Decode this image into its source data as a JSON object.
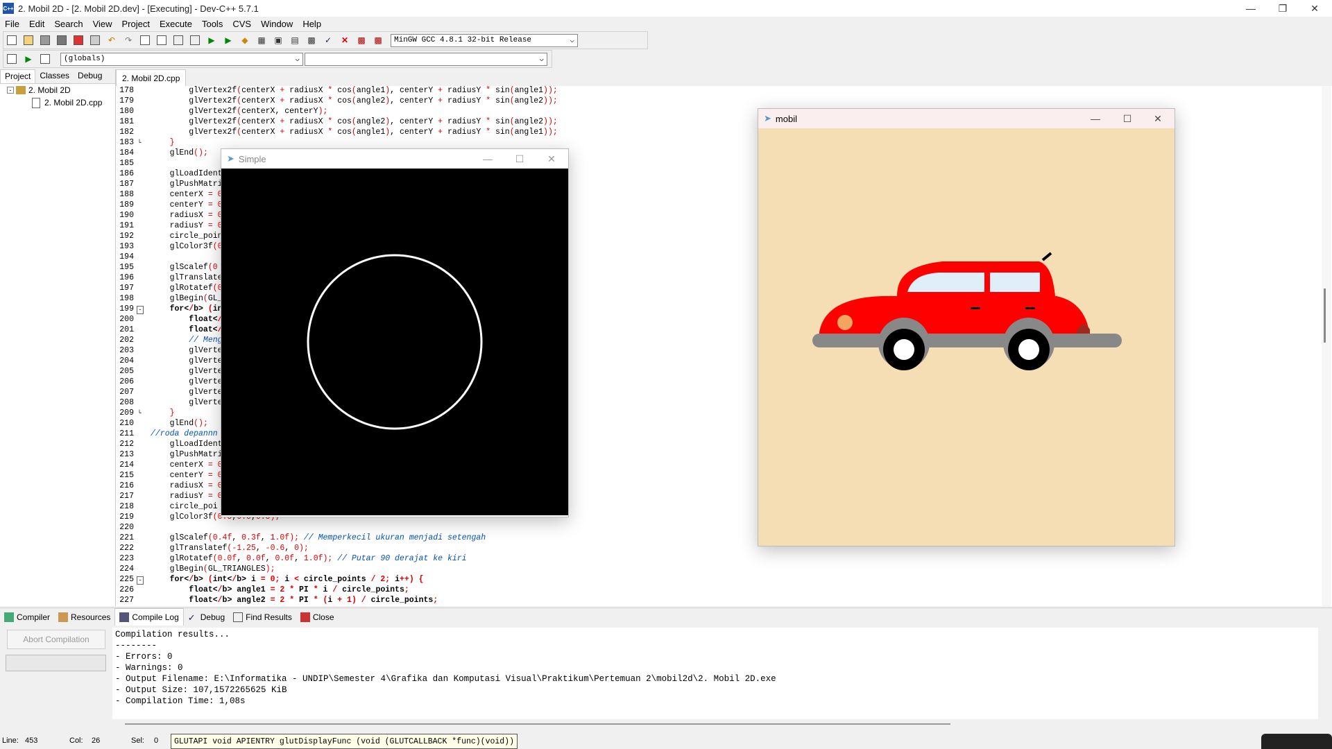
{
  "window": {
    "title": "2. Mobil 2D - [2. Mobil 2D.dev] - [Executing] - Dev-C++ 5.7.1",
    "icon": "devcpp-icon"
  },
  "menu": [
    "File",
    "Edit",
    "Search",
    "View",
    "Project",
    "Execute",
    "Tools",
    "CVS",
    "Window",
    "Help"
  ],
  "toolbar": {
    "compiler": "MinGW GCC 4.8.1 32-bit Release",
    "scope": "(globals)",
    "members": ""
  },
  "left_panel": {
    "tabs": [
      "Project",
      "Classes",
      "Debug"
    ],
    "tree": [
      {
        "label": "2. Mobil 2D",
        "level": 0
      },
      {
        "label": "2. Mobil 2D.cpp",
        "level": 1
      }
    ]
  },
  "editor": {
    "tab": "2. Mobil 2D.cpp",
    "lines": [
      {
        "n": "178",
        "t": "        glVertex2f(centerX + radiusX * cos(angle1), centerY + radiusY * sin(angle1));"
      },
      {
        "n": "179",
        "t": "        glVertex2f(centerX + radiusX * cos(angle2), centerY + radiusY * sin(angle2));"
      },
      {
        "n": "180",
        "t": "        glVertex2f(centerX, centerY);"
      },
      {
        "n": "181",
        "t": "        glVertex2f(centerX + radiusX * cos(angle2), centerY + radiusY * sin(angle2));"
      },
      {
        "n": "182",
        "t": "        glVertex2f(centerX + radiusX * cos(angle1), centerY + radiusY * sin(angle1));"
      },
      {
        "n": "183",
        "t": "    }"
      },
      {
        "n": "184",
        "t": "    glEnd();"
      },
      {
        "n": "185",
        "t": ""
      },
      {
        "n": "186",
        "t": "    glLoadIdent"
      },
      {
        "n": "187",
        "t": "    glPushMatri"
      },
      {
        "n": "188",
        "t": "    centerX = 0"
      },
      {
        "n": "189",
        "t": "    centerY = 0"
      },
      {
        "n": "190",
        "t": "    radiusX = 0"
      },
      {
        "n": "191",
        "t": "    radiusY = 0"
      },
      {
        "n": "192",
        "t": "    circle_poin"
      },
      {
        "n": "193",
        "t": "    glColor3f(0"
      },
      {
        "n": "194",
        "t": ""
      },
      {
        "n": "195",
        "t": "    glScalef(0"
      },
      {
        "n": "196",
        "t": "    glTranslate"
      },
      {
        "n": "197",
        "t": "    glRotatef(0"
      },
      {
        "n": "198",
        "t": "    glBegin(GL_"
      },
      {
        "n": "199",
        "t": "    for (int i"
      },
      {
        "n": "200",
        "t": "        float a"
      },
      {
        "n": "201",
        "t": "        float a"
      },
      {
        "n": "202",
        "t": "        // Meng"
      },
      {
        "n": "203",
        "t": "        glVerte"
      },
      {
        "n": "204",
        "t": "        glVerte"
      },
      {
        "n": "205",
        "t": "        glVerte"
      },
      {
        "n": "206",
        "t": "        glVerte"
      },
      {
        "n": "207",
        "t": "        glVerte"
      },
      {
        "n": "208",
        "t": "        glVerte"
      },
      {
        "n": "209",
        "t": "    }"
      },
      {
        "n": "210",
        "t": "    glEnd();"
      },
      {
        "n": "211",
        "t": "//roda depannn"
      },
      {
        "n": "212",
        "t": "    glLoadIdent"
      },
      {
        "n": "213",
        "t": "    glPushMatri"
      },
      {
        "n": "214",
        "t": "    centerX = 0"
      },
      {
        "n": "215",
        "t": "    centerY = 0"
      },
      {
        "n": "216",
        "t": "    radiusX = 0"
      },
      {
        "n": "217",
        "t": "    radiusY = 0"
      },
      {
        "n": "218",
        "t": "    circle_poi"
      },
      {
        "n": "219",
        "t": "    glColor3f(0.5,0.5,0.5);"
      },
      {
        "n": "220",
        "t": ""
      },
      {
        "n": "221",
        "t": "    glScalef(0.4f, 0.3f, 1.0f); // Memperkecil ukuran menjadi setengah"
      },
      {
        "n": "222",
        "t": "    glTranslatef(-1.25, -0.6, 0);"
      },
      {
        "n": "223",
        "t": "    glRotatef(0.0f, 0.0f, 0.0f, 1.0f); // Putar 90 derajat ke kiri"
      },
      {
        "n": "224",
        "t": "    glBegin(GL_TRIANGLES);"
      },
      {
        "n": "225",
        "t": "    for (int i = 0; i < circle_points / 2; i++) {"
      },
      {
        "n": "226",
        "t": "        float angle1 = 2 * PI * i / circle_points;"
      },
      {
        "n": "227",
        "t": "        float angle2 = 2 * PI * (i + 1) / circle_points;"
      }
    ]
  },
  "simple_window": {
    "title": "Simple"
  },
  "mobil_window": {
    "title": "mobil",
    "bg": "#f5deb3",
    "car_color": "#ff0000"
  },
  "bottom": {
    "tabs": [
      "Compiler",
      "Resources",
      "Compile Log",
      "Debug",
      "Find Results",
      "Close"
    ],
    "abort": "Abort Compilation",
    "log": [
      "Compilation results...",
      "--------",
      "- Errors: 0",
      "- Warnings: 0",
      "- Output Filename: E:\\Informatika - UNDIP\\Semester 4\\Grafika dan Komputasi Visual\\Praktikum\\Pertemuan 2\\mobil2d\\2. Mobil 2D.exe",
      "- Output Size: 107,1572265625 KiB",
      "- Compilation Time: 1,08s"
    ]
  },
  "status": {
    "line_label": "Line:",
    "line": "453",
    "col_label": "Col:",
    "col": "26",
    "sel_label": "Sel:",
    "sel": "0",
    "hint": "GLUTAPI void APIENTRY glutDisplayFunc (void (GLUTCALLBACK *func)(void))"
  }
}
